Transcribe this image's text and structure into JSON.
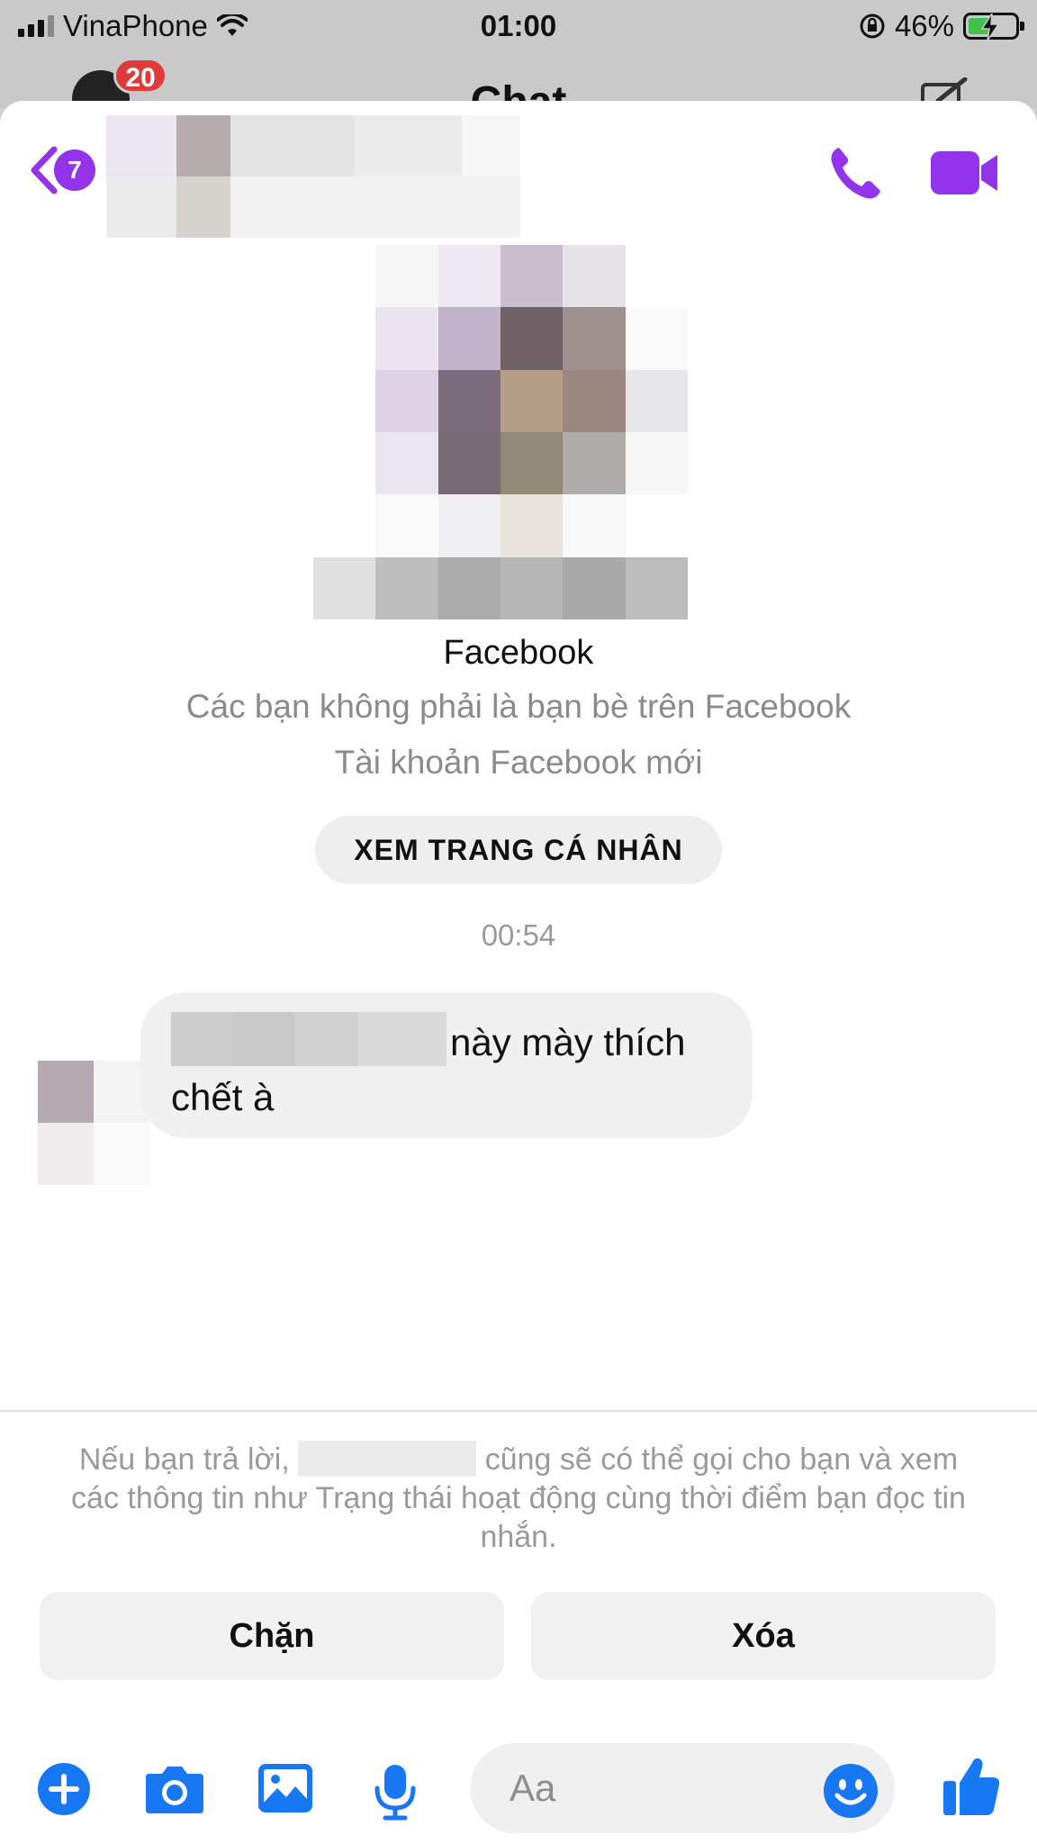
{
  "status_bar": {
    "carrier": "VinaPhone",
    "time": "01:00",
    "battery_percent": "46%",
    "battery_level": 0.46,
    "icons": [
      "signal-icon",
      "wifi-icon",
      "orientation-lock-icon",
      "battery-charging-icon"
    ]
  },
  "behind": {
    "unread_badge": "20",
    "title": "Chat"
  },
  "header": {
    "back_count": "7",
    "icons": [
      "back-chevron-icon",
      "phone-icon",
      "video-camera-icon"
    ]
  },
  "profile": {
    "name": "Facebook",
    "relationship": "Các bạn không phải là bạn bè trên Facebook",
    "account_note": "Tài khoản Facebook mới",
    "view_profile_label": "XEM TRANG CÁ NHÂN"
  },
  "conversation": {
    "timestamp": "00:54",
    "messages": [
      {
        "text_visible": "này mày thích chết à"
      }
    ]
  },
  "request_panel": {
    "notice_before": "Nếu bạn trả lời,",
    "notice_after": "cũng sẽ có thể gọi cho bạn và xem các thông tin như Trạng thái hoạt động cùng thời điểm bạn đọc tin nhắn.",
    "block_label": "Chặn",
    "delete_label": "Xóa"
  },
  "composer": {
    "placeholder": "Aa",
    "icons": [
      "plus-icon",
      "camera-icon",
      "gallery-icon",
      "microphone-icon",
      "emoji-icon",
      "thumbs-up-icon"
    ]
  },
  "colors": {
    "accent_purple": "#9333ea",
    "messenger_blue": "#1877f2",
    "badge_red": "#e03b3b",
    "battery_green": "#3fc24a"
  }
}
